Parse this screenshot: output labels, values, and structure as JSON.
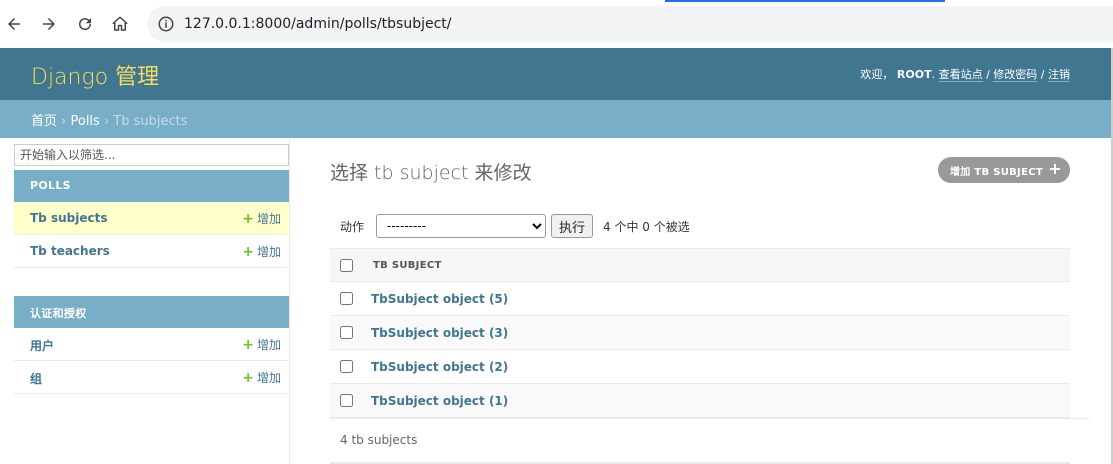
{
  "browser": {
    "url": "127.0.0.1:8000/admin/polls/tbsubject/"
  },
  "header": {
    "branding": "Django 管理",
    "welcome": "欢迎，",
    "username": "ROOT",
    "view_site": "查看站点",
    "change_password": "修改密码",
    "logout": "注销",
    "separator": " / "
  },
  "breadcrumbs": {
    "home": "首页",
    "app": "Polls",
    "current": "Tb subjects",
    "sep": " › "
  },
  "sidebar": {
    "filter_placeholder": "开始输入以筛选...",
    "modules": [
      {
        "caption": "POLLS",
        "rows": [
          {
            "name": "Tb subjects",
            "add": "增加"
          },
          {
            "name": "Tb teachers",
            "add": "增加"
          }
        ]
      },
      {
        "caption": "认证和授权",
        "rows": [
          {
            "name": "用户",
            "add": "增加"
          },
          {
            "name": "组",
            "add": "增加"
          }
        ]
      }
    ]
  },
  "content": {
    "title": "选择 tb subject 来修改",
    "add_button": "增加 TB SUBJECT",
    "actions": {
      "label": "动作",
      "selected_option": "---------",
      "go_button": "执行",
      "counter": "4 个中 0 个被选"
    },
    "table": {
      "column_header": "TB SUBJECT",
      "rows": [
        "TbSubject object (5)",
        "TbSubject object (3)",
        "TbSubject object (2)",
        "TbSubject object (1)"
      ]
    },
    "paginator": "4 tb subjects"
  },
  "colors": {
    "header_bg": "#417690",
    "breadcrumb_bg": "#79aec8",
    "branding": "#f5dd5d",
    "link": "#417690",
    "add_green": "#70bf2b",
    "selected_row": "#ffffcc"
  }
}
